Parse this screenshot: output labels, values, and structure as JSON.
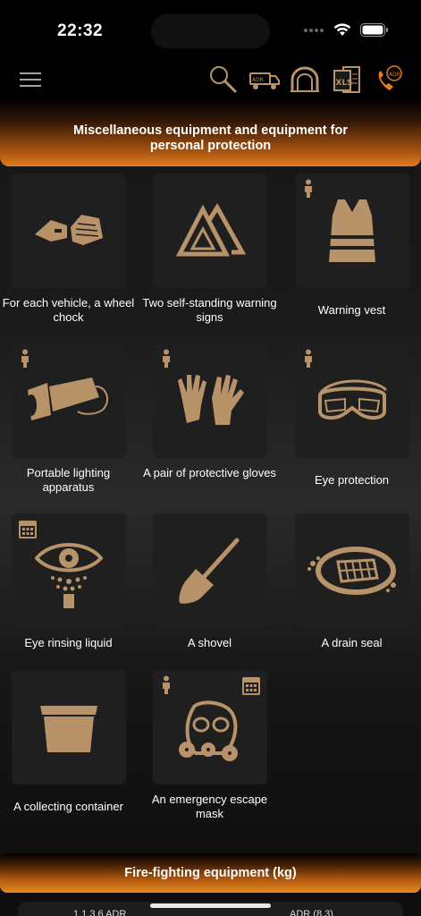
{
  "status": {
    "time": "22:32"
  },
  "colors": {
    "accent": "#e07d1e",
    "icon": "#b89268",
    "tile_bg": "#1f1f1f"
  },
  "nav": {
    "icons": [
      "menu-icon",
      "search-icon",
      "truck-icon",
      "tunnel-icon",
      "xls-icon",
      "adr-phone-icon"
    ],
    "adr_badge": "ADR",
    "xls_label": "XLS"
  },
  "section1": {
    "title": "Miscellaneous equipment and equipment for personal protection"
  },
  "items": [
    {
      "label": "For each vehicle, a wheel chock",
      "icon": "wheel-chock-icon"
    },
    {
      "label": "Two self-standing warning signs",
      "icon": "warning-triangle-icon"
    },
    {
      "label": "Warning vest",
      "icon": "warning-vest-icon",
      "badge": "person-icon"
    },
    {
      "label": "Portable lighting apparatus",
      "icon": "flashlight-icon",
      "badge": "person-icon"
    },
    {
      "label": "A pair of protective gloves",
      "icon": "gloves-icon",
      "badge": "person-icon"
    },
    {
      "label": "Eye protection",
      "icon": "goggles-icon",
      "badge": "person-icon"
    },
    {
      "label": "Eye rinsing liquid",
      "icon": "eye-rinse-icon",
      "badge": "calendar-icon"
    },
    {
      "label": "A shovel",
      "icon": "shovel-icon"
    },
    {
      "label": "A drain seal",
      "icon": "drain-seal-icon"
    },
    {
      "label": "A collecting container",
      "icon": "container-icon"
    },
    {
      "label": "An emergency escape mask",
      "icon": "gas-mask-icon",
      "badge": "person-icon",
      "badge2": "calendar-icon"
    }
  ],
  "section2": {
    "title": "Fire-fighting equipment (kg)"
  },
  "bottom_tabs": [
    "1.1.3.6 ADR",
    "ADR (8.3)"
  ]
}
